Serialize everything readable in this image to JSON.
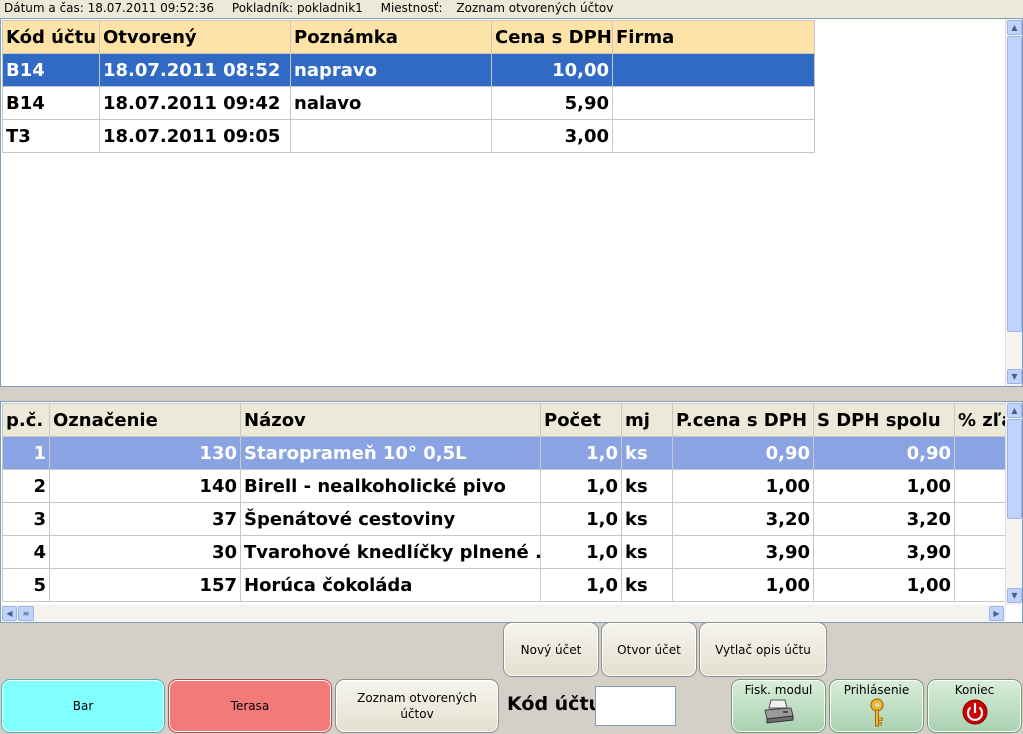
{
  "status": {
    "datetime": "Dátum a čas: 18.07.2011 09:52:36",
    "cashier": "Pokladník: pokladnik1",
    "room": "Miestnosť:",
    "view": "Zoznam otvorených účtov"
  },
  "accounts": {
    "headers": [
      "Kód účtu",
      "Otvorený",
      "Poznámka",
      "Cena s DPH",
      "Firma"
    ],
    "rows": [
      {
        "code": "B14",
        "opened": "18.07.2011  08:52",
        "note": "napravo",
        "price": "10,00",
        "firm": ""
      },
      {
        "code": "B14",
        "opened": "18.07.2011  09:42",
        "note": "nalavo",
        "price": "5,90",
        "firm": ""
      },
      {
        "code": "T3",
        "opened": "18.07.2011  09:05",
        "note": "",
        "price": "3,00",
        "firm": ""
      }
    ]
  },
  "items": {
    "headers": [
      "p.č.",
      "Označenie",
      "Názov",
      "Počet",
      "mj",
      "P.cena s DPH",
      "S DPH spolu",
      "% zľa"
    ],
    "rows": [
      {
        "pc": "1",
        "code": "130",
        "name": "Staroprameň 10° 0,5L",
        "qty": "1,0",
        "unit": "ks",
        "unit_price": "0,90",
        "total": "0,90",
        "disc": ""
      },
      {
        "pc": "2",
        "code": "140",
        "name": "Birell - nealkoholické pivo",
        "qty": "1,0",
        "unit": "ks",
        "unit_price": "1,00",
        "total": "1,00",
        "disc": ""
      },
      {
        "pc": "3",
        "code": "37",
        "name": "Špenátové cestoviny",
        "qty": "1,0",
        "unit": "ks",
        "unit_price": "3,20",
        "total": "3,20",
        "disc": ""
      },
      {
        "pc": "4",
        "code": "30",
        "name": "Tvarohové knedlíčky plnené ...",
        "qty": "1,0",
        "unit": "ks",
        "unit_price": "3,90",
        "total": "3,90",
        "disc": ""
      },
      {
        "pc": "5",
        "code": "157",
        "name": "Horúca čokoláda",
        "qty": "1,0",
        "unit": "ks",
        "unit_price": "1,00",
        "total": "1,00",
        "disc": ""
      }
    ]
  },
  "actions": {
    "new_account": "Nový účet",
    "open_account": "Otvor účet",
    "print_account": "Vytlač opis účtu"
  },
  "rooms": {
    "bar": "Bar",
    "terasa": "Terasa",
    "open_list": "Zoznam otvorených účtov"
  },
  "kod_label": "Kód účtu",
  "kod_value": "",
  "system": {
    "fisk": "Fisk. modul",
    "login": "Prihlásenie",
    "exit": "Koniec"
  },
  "colors": {
    "selected_row": "#316ac5",
    "selected_item_row": "#8aa3e3",
    "header_top": "#fde3a7",
    "bar_button": "#80ffff",
    "terasa_button": "#f47a7a"
  }
}
